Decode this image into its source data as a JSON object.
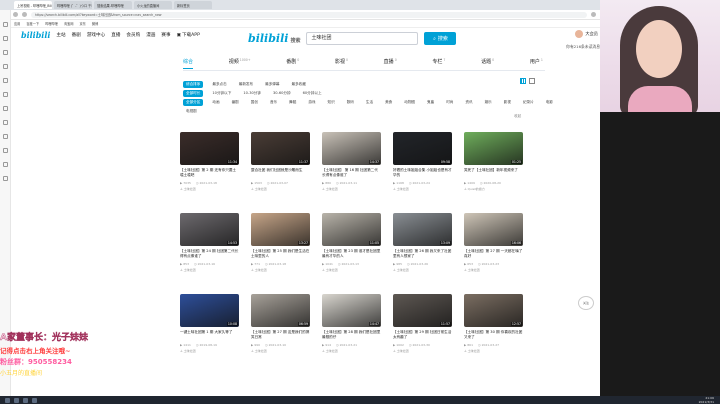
{
  "browser": {
    "tabs": [
      "上吊视频 - 哔哩哔哩_Bilibili",
      "哔哩哔哩 (゜-゜)つロ 千杯~-bilibili",
      "搜索结果-哔哩哔哩",
      "小火龙的直播间",
      "新标签页"
    ],
    "url": "https://search.bilibili.com/all?keyword=土味社团&from_source=nav_search_new",
    "bookmarks": [
      "应用",
      "百度一下",
      "哔哩哔哩",
      "淘宝网",
      "京东",
      "微博"
    ]
  },
  "topnav": {
    "logo": "bilibili",
    "links": [
      "主站",
      "番剧",
      "游戏中心",
      "直播",
      "会员购",
      "漫画",
      "赛事"
    ],
    "download": "下载APP",
    "username": "大会员",
    "tip": "你有216条未读消息"
  },
  "search": {
    "logo": "bilibili",
    "sub": "搜索",
    "query": "土味社团",
    "button": "搜索"
  },
  "categories": [
    {
      "label": "综合",
      "count": ""
    },
    {
      "label": "视频",
      "count": "1000+"
    },
    {
      "label": "番剧",
      "count": "0"
    },
    {
      "label": "影视",
      "count": "0"
    },
    {
      "label": "直播",
      "count": "0"
    },
    {
      "label": "专栏",
      "count": "7"
    },
    {
      "label": "话题",
      "count": "0"
    },
    {
      "label": "用户",
      "count": "1"
    }
  ],
  "filters": {
    "order": [
      "综合排序",
      "最多点击",
      "最新发布",
      "最多弹幕",
      "最多收藏"
    ],
    "duration": [
      "全部时长",
      "10分钟以下",
      "10-30分钟",
      "30-60分钟",
      "60分钟以上"
    ],
    "zone": [
      "全部分区",
      "动画",
      "番剧",
      "国创",
      "音乐",
      "舞蹈",
      "游戏",
      "知识",
      "数码",
      "生活",
      "美食",
      "动物圈",
      "鬼畜",
      "时尚",
      "资讯",
      "娱乐",
      "影视",
      "纪录片",
      "电影"
    ],
    "zone_extra": "电视剧",
    "more": "收起"
  },
  "videos": [
    {
      "duration": "11:34",
      "title": "【土味社团】第 2 期 还有你只要土嘻土嘻吧",
      "views": "7035",
      "date": "2021-03-18",
      "up": "土味社团"
    },
    {
      "duration": "11:37",
      "title": "整合社团 我们社团就是沙雕而生",
      "views": "1503",
      "date": "2021-03-07",
      "up": "土味社团"
    },
    {
      "duration": "14:37",
      "title": "【土味社团】 第 16 期 社团第二代长得有点像谁了",
      "views": "880",
      "date": "2021-03-11",
      "up": "土味社团"
    },
    {
      "duration": "09:58",
      "title": "好看的土味姐姐合集 小姐姐也是有才华的",
      "views": "1168",
      "date": "2021-03-24",
      "up": "土味社团"
    },
    {
      "duration": "01:25",
      "title": "笑死了【土味社团】新年视频来了",
      "views": "1409",
      "date": "2020-08-20",
      "up": "Quiet的魔力"
    },
    {
      "duration": "14:53",
      "title": "【土味社团】第 24 期 社团第二代长得有点像谁了",
      "views": "853",
      "date": "2021-03-16",
      "up": "土味社团"
    },
    {
      "duration": "13:27",
      "title": "【土味社团】第 25 期 我们是生活在土味里的人",
      "views": "771",
      "date": "2021-03-18",
      "up": "土味社团"
    },
    {
      "duration": "11:05",
      "title": "【土味社团】第 23 期 谁才是社团里最有才华的人",
      "views": "1041",
      "date": "2021-03-13",
      "up": "土味社团"
    },
    {
      "duration": "13:09",
      "title": "【土味社团】第 26 期 我又来了社团里有人想家了",
      "views": "985",
      "date": "2021-03-26",
      "up": "土味社团"
    },
    {
      "duration": "16:06",
      "title": "【土味社团】第 27 期 一天都在嗨了真好",
      "views": "653",
      "date": "2021-03-23",
      "up": "土味社团"
    },
    {
      "duration": "10:08",
      "title": "一键土味社团第 1 期 大家久等了",
      "views": "1411",
      "date": "2019-08-19",
      "up": "土味社团"
    },
    {
      "duration": "06:59",
      "title": "【土味社团】第 27 期 这是我们的搞笑日常",
      "views": "990",
      "date": "2021-03-10",
      "up": "土味社团"
    },
    {
      "duration": "14:47",
      "title": "【土味社团】第 28 期 我们是社团里最靓的仔",
      "views": "914",
      "date": "2021-03-21",
      "up": "土味社团"
    },
    {
      "duration": "11:57",
      "title": "【土味社团】第 29 期 社团日常生活太有趣了",
      "views": "1002",
      "date": "2021-03-30",
      "up": "土味社团"
    },
    {
      "duration": "12:57",
      "title": "【土味社团】第 30 期 你喜欢的社团又来了",
      "views": "861",
      "date": "2021-03-27",
      "up": "土味社团"
    }
  ],
  "overlay": {
    "line1": "A家董事长：光子妹妹",
    "line2": "记得点击右上角关注哦~",
    "line3": "粉丝群：950558234",
    "line4": "小五月的直播间"
  },
  "clock": {
    "time": "21:06",
    "date": "2021/3/31"
  },
  "float_bubble": "关注",
  "thumb_colors": [
    "#3b2d2a",
    "#4a3d36",
    "#c9c2b8",
    "#22252a",
    "#6fae5c",
    "#6d6a6e",
    "#c7a689",
    "#b9b4aa",
    "#8a8f94",
    "#cfc6b8",
    "#2e4f9a",
    "#a8a29a",
    "#d9d6cf",
    "#5e5853",
    "#7b6e62"
  ]
}
